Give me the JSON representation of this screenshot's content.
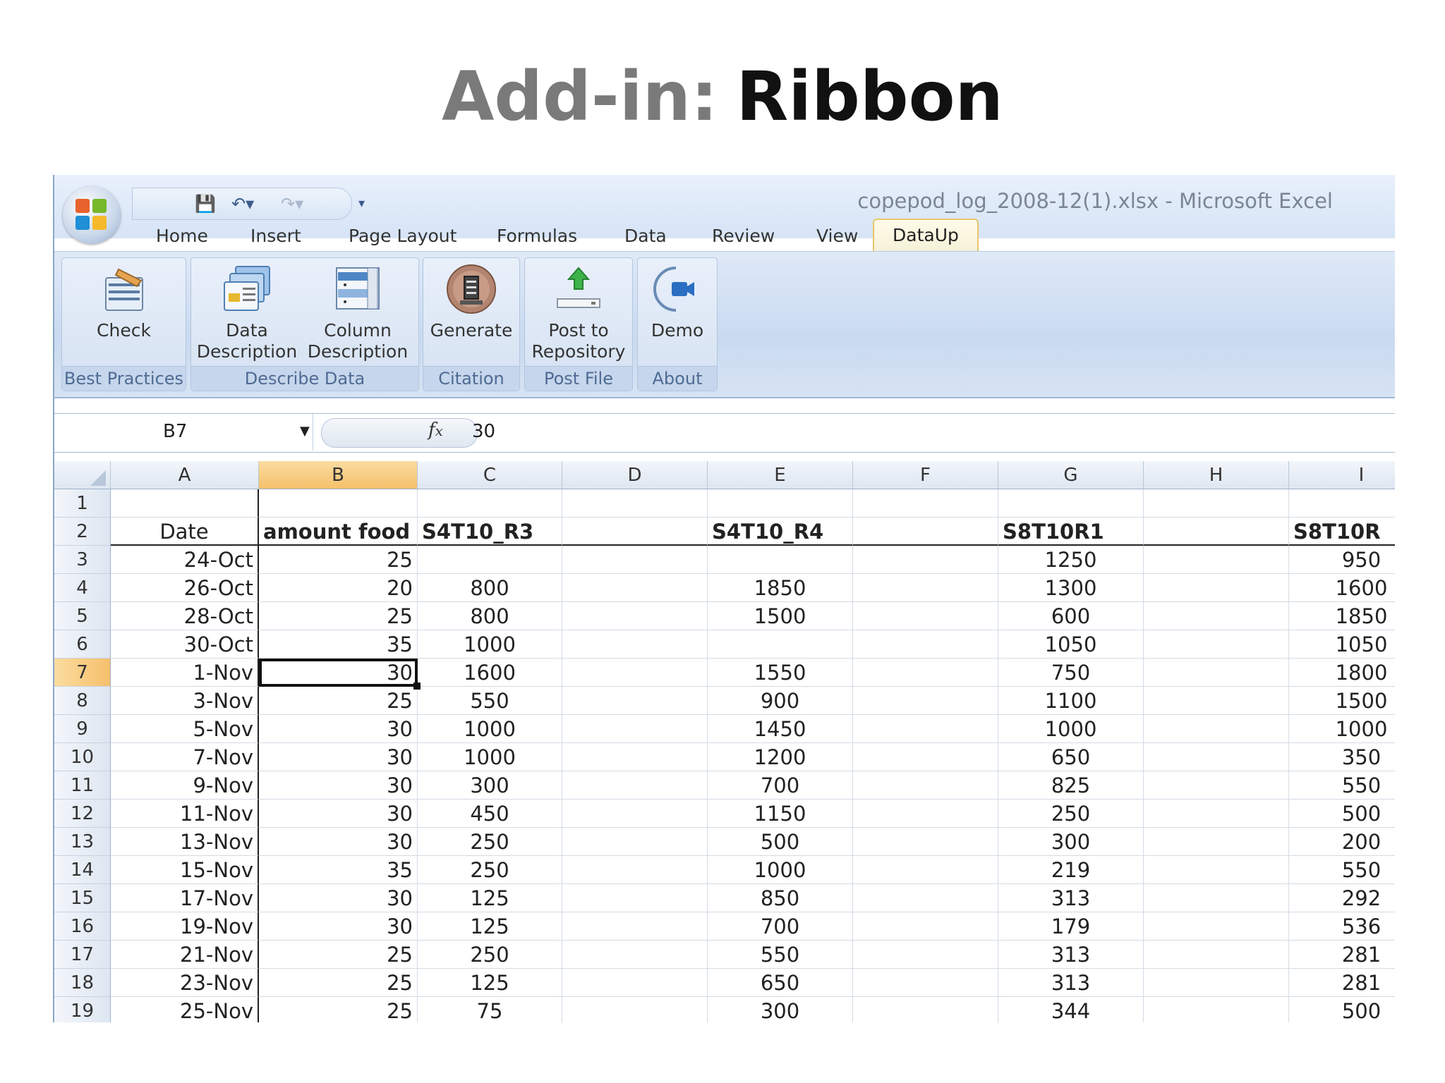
{
  "slide": {
    "title_part1": "Add-in:",
    "title_part2": "Ribbon"
  },
  "window": {
    "title": "copepod_log_2008-12(1).xlsx - Microsoft Excel"
  },
  "tabs": [
    "Home",
    "Insert",
    "Page Layout",
    "Formulas",
    "Data",
    "Review",
    "View",
    "DataUp"
  ],
  "active_tab": "DataUp",
  "ribbon": {
    "groups": [
      {
        "label": "Best Practices",
        "buttons": [
          {
            "line1": "Check",
            "line2": "",
            "icon": "checklist-icon"
          }
        ]
      },
      {
        "label": "Describe Data",
        "buttons": [
          {
            "line1": "Data",
            "line2": "Description",
            "icon": "data-description-icon"
          },
          {
            "line1": "Column",
            "line2": "Description",
            "icon": "column-description-icon"
          }
        ]
      },
      {
        "label": "Citation",
        "buttons": [
          {
            "line1": "Generate",
            "line2": "",
            "icon": "generate-citation-icon"
          }
        ]
      },
      {
        "label": "Post File",
        "buttons": [
          {
            "line1": "Post to",
            "line2": "Repository",
            "icon": "upload-arrow-icon"
          }
        ]
      },
      {
        "label": "About",
        "buttons": [
          {
            "line1": "Demo",
            "line2": "",
            "icon": "video-camera-icon"
          }
        ]
      }
    ]
  },
  "formula_bar": {
    "name_box": "B7",
    "fx_label": "fx",
    "value": "30"
  },
  "sheet": {
    "columns": [
      "A",
      "B",
      "C",
      "D",
      "E",
      "F",
      "G",
      "H",
      "I"
    ],
    "selected_column": "B",
    "selected_row": 7,
    "rows": [
      {
        "num": "1",
        "cells": [
          "",
          "",
          "",
          "",
          "",
          "",
          "",
          "",
          ""
        ]
      },
      {
        "num": "2",
        "cells": [
          "Date",
          "amount food",
          "S4T10_R3",
          "",
          "S4T10_R4",
          "",
          "S8T10R1",
          "",
          "S8T10R"
        ]
      },
      {
        "num": "3",
        "cells": [
          "24-Oct",
          "25",
          "",
          "",
          "",
          "",
          "1250",
          "",
          "950"
        ]
      },
      {
        "num": "4",
        "cells": [
          "26-Oct",
          "20",
          "800",
          "",
          "1850",
          "",
          "1300",
          "",
          "1600"
        ]
      },
      {
        "num": "5",
        "cells": [
          "28-Oct",
          "25",
          "800",
          "",
          "1500",
          "",
          "600",
          "",
          "1850"
        ]
      },
      {
        "num": "6",
        "cells": [
          "30-Oct",
          "35",
          "1000",
          "",
          "",
          "",
          "1050",
          "",
          "1050"
        ]
      },
      {
        "num": "7",
        "cells": [
          "1-Nov",
          "30",
          "1600",
          "",
          "1550",
          "",
          "750",
          "",
          "1800"
        ]
      },
      {
        "num": "8",
        "cells": [
          "3-Nov",
          "25",
          "550",
          "",
          "900",
          "",
          "1100",
          "",
          "1500"
        ]
      },
      {
        "num": "9",
        "cells": [
          "5-Nov",
          "30",
          "1000",
          "",
          "1450",
          "",
          "1000",
          "",
          "1000"
        ]
      },
      {
        "num": "10",
        "cells": [
          "7-Nov",
          "30",
          "1000",
          "",
          "1200",
          "",
          "650",
          "",
          "350"
        ]
      },
      {
        "num": "11",
        "cells": [
          "9-Nov",
          "30",
          "300",
          "",
          "700",
          "",
          "825",
          "",
          "550"
        ]
      },
      {
        "num": "12",
        "cells": [
          "11-Nov",
          "30",
          "450",
          "",
          "1150",
          "",
          "250",
          "",
          "500"
        ]
      },
      {
        "num": "13",
        "cells": [
          "13-Nov",
          "30",
          "250",
          "",
          "500",
          "",
          "300",
          "",
          "200"
        ]
      },
      {
        "num": "14",
        "cells": [
          "15-Nov",
          "35",
          "250",
          "",
          "1000",
          "",
          "219",
          "",
          "550"
        ]
      },
      {
        "num": "15",
        "cells": [
          "17-Nov",
          "30",
          "125",
          "",
          "850",
          "",
          "313",
          "",
          "292"
        ]
      },
      {
        "num": "16",
        "cells": [
          "19-Nov",
          "30",
          "125",
          "",
          "700",
          "",
          "179",
          "",
          "536"
        ]
      },
      {
        "num": "17",
        "cells": [
          "21-Nov",
          "25",
          "250",
          "",
          "550",
          "",
          "313",
          "",
          "281"
        ]
      },
      {
        "num": "18",
        "cells": [
          "23-Nov",
          "25",
          "125",
          "",
          "650",
          "",
          "313",
          "",
          "281"
        ]
      },
      {
        "num": "19",
        "cells": [
          "25-Nov",
          "25",
          "75",
          "",
          "300",
          "",
          "344",
          "",
          "500"
        ]
      }
    ]
  }
}
